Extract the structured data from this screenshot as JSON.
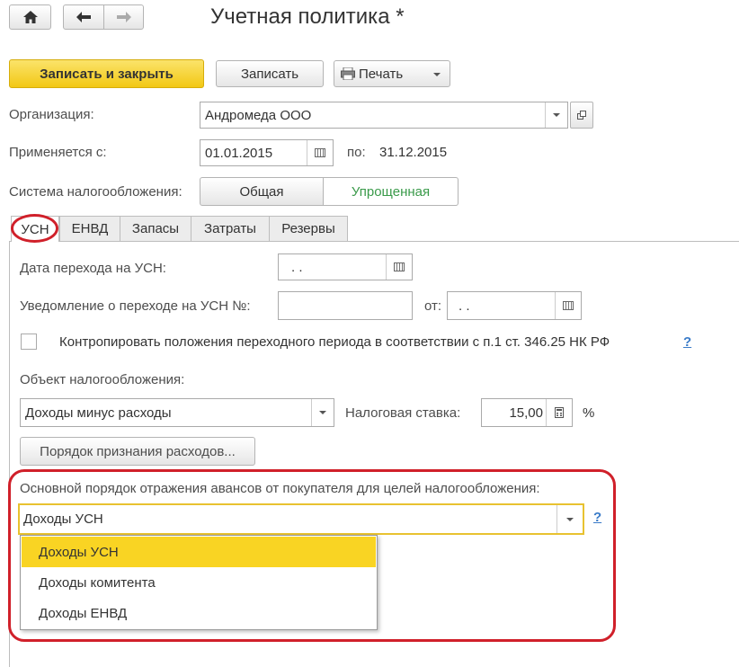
{
  "window": {
    "title": "Учетная политика *"
  },
  "toolbar": {
    "save_close_label": "Записать и закрыть",
    "save_label": "Записать",
    "print_label": "Печать"
  },
  "form": {
    "org_label": "Организация:",
    "org_value": "Андромеда ООО",
    "applies_label": "Применяется с:",
    "applies_value": "01.01.2015",
    "to_label": "по:",
    "to_value": "31.12.2015",
    "tax_system_label": "Система налогообложения:",
    "tax_system_options": [
      "Общая",
      "Упрощенная"
    ],
    "tax_system_selected": "Упрощенная"
  },
  "tabs": [
    {
      "label": "УСН",
      "active": true
    },
    {
      "label": "ЕНВД",
      "active": false
    },
    {
      "label": "Запасы",
      "active": false
    },
    {
      "label": "Затраты",
      "active": false
    },
    {
      "label": "Резервы",
      "active": false
    }
  ],
  "usn": {
    "transition_date_label": "Дата перехода на УСН:",
    "transition_date_value": " .  .",
    "notice_label": "Уведомление о переходе на УСН №:",
    "notice_value": "",
    "from_label": "от:",
    "from_value": " .  .",
    "control_checkbox_label": "Контропировать положения переходного периода в соответствии с п.1 ст. 346.25 НК РФ",
    "control_checked": false,
    "help_label": "?",
    "object_label": "Объект налогообложения:",
    "object_value": "Доходы минус расходы",
    "rate_label": "Налоговая ставка:",
    "rate_value": "15,00",
    "rate_unit": "%",
    "expenses_button_label": "Порядок признания расходов...",
    "advances_label": "Основной порядок отражения авансов от покупателя для целей налогообложения:",
    "advances_value": "Доходы УСН",
    "advances_options": [
      "Доходы УСН",
      "Доходы комитента",
      "Доходы ЕНВД"
    ],
    "advances_highlighted": "Доходы УСН"
  },
  "colors": {
    "primary_button": "#f5d020",
    "selected_green": "#3a9a4a",
    "annotation_red": "#d0202a",
    "dropdown_highlight": "#f9d423",
    "focus_border": "#e8c230"
  }
}
